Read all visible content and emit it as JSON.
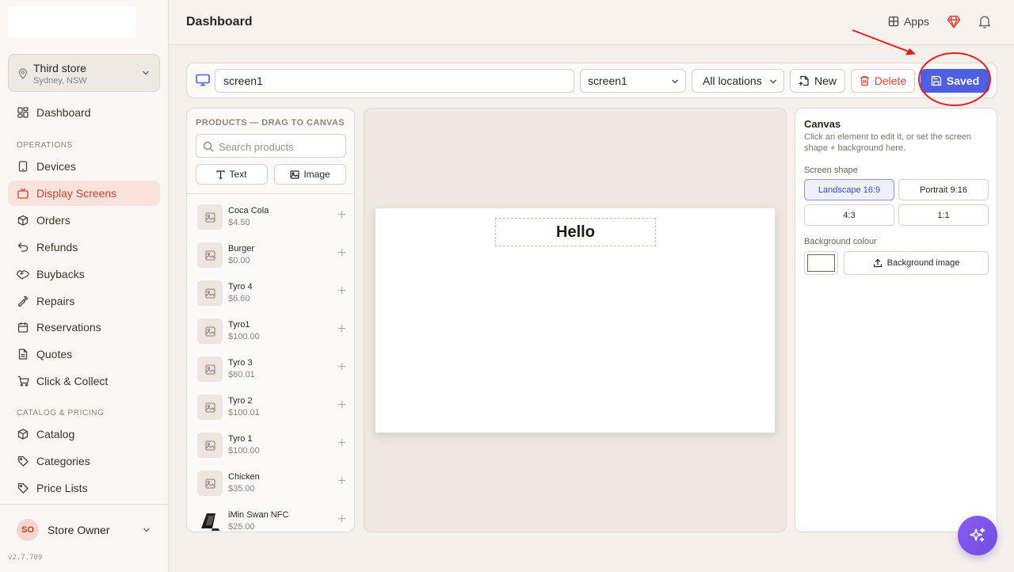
{
  "sidebar": {
    "store": {
      "name": "Third store",
      "location": "Sydney, NSW"
    },
    "top_items": [
      {
        "label": "Dashboard",
        "icon": "dashboard-icon"
      }
    ],
    "sections": [
      {
        "label": "OPERATIONS",
        "items": [
          {
            "label": "Devices",
            "icon": "tablet-icon"
          },
          {
            "label": "Display Screens",
            "icon": "tv-icon",
            "active": true
          },
          {
            "label": "Orders",
            "icon": "box-icon"
          },
          {
            "label": "Refunds",
            "icon": "undo-icon"
          },
          {
            "label": "Buybacks",
            "icon": "handshake-icon"
          },
          {
            "label": "Repairs",
            "icon": "wrench-icon"
          },
          {
            "label": "Reservations",
            "icon": "calendar-icon"
          },
          {
            "label": "Quotes",
            "icon": "document-icon"
          },
          {
            "label": "Click & Collect",
            "icon": "cart-icon"
          }
        ]
      },
      {
        "label": "CATALOG & PRICING",
        "items": [
          {
            "label": "Catalog",
            "icon": "package-icon"
          },
          {
            "label": "Categories",
            "icon": "tag-icon"
          },
          {
            "label": "Price Lists",
            "icon": "tag-icon"
          }
        ]
      }
    ],
    "user": {
      "initials": "SO",
      "name": "Store Owner"
    },
    "version": "v2.7.709"
  },
  "header": {
    "title": "Dashboard",
    "apps_label": "Apps"
  },
  "toolbar": {
    "screen_name_value": "screen1",
    "screen_select_value": "screen1",
    "location_select_value": "All locations",
    "new_label": "New",
    "delete_label": "Delete",
    "saved_label": "Saved",
    "accent_color": "#4f5fe0",
    "delete_color": "#d9453a"
  },
  "products_panel": {
    "heading": "PRODUCTS — DRAG TO CANVAS",
    "search_placeholder": "Search products",
    "text_button": "Text",
    "image_button": "Image",
    "products": [
      {
        "name": "Coca Cola",
        "price": "$4.50"
      },
      {
        "name": "Burger",
        "price": "$0.00"
      },
      {
        "name": "Tyro 4",
        "price": "$6.60"
      },
      {
        "name": "Tyro1",
        "price": "$100.00"
      },
      {
        "name": "Tyro 3",
        "price": "$60.01"
      },
      {
        "name": "Tyro 2",
        "price": "$100.01"
      },
      {
        "name": "Tyro 1",
        "price": "$100.00"
      },
      {
        "name": "Chicken",
        "price": "$35.00"
      },
      {
        "name": "iMin Swan NFC",
        "price": "$25.00",
        "has_photo": true
      }
    ]
  },
  "canvas": {
    "text_element": "Hello",
    "background_color": "#ffffff"
  },
  "properties": {
    "title": "Canvas",
    "description": "Click an element to edit it, or set the screen shape + background here.",
    "screen_shape_label": "Screen shape",
    "shapes": [
      {
        "label": "Landscape 16:9",
        "selected": true
      },
      {
        "label": "Portrait 9:16",
        "selected": false
      },
      {
        "label": "4:3",
        "selected": false
      },
      {
        "label": "1:1",
        "selected": false
      }
    ],
    "background_colour_label": "Background colour",
    "background_image_label": "Background image"
  }
}
